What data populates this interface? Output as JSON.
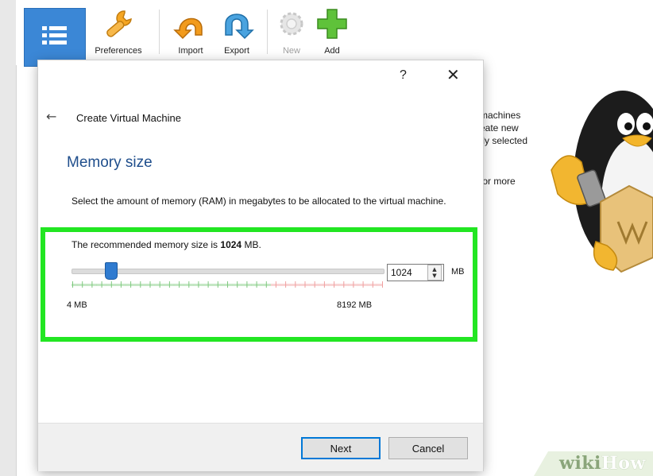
{
  "toolbar": {
    "items": [
      {
        "label": "Preferences",
        "icon": "wrench-icon",
        "enabled": true
      },
      {
        "label": "Import",
        "icon": "import-arrow-icon",
        "enabled": true
      },
      {
        "label": "Export",
        "icon": "export-arrow-icon",
        "enabled": true
      },
      {
        "label": "New",
        "icon": "new-gear-icon",
        "enabled": false
      },
      {
        "label": "Add",
        "icon": "plus-icon",
        "enabled": true
      }
    ]
  },
  "welcome": {
    "lines": [
      "machines",
      "eate new",
      "tly selected",
      "for more"
    ]
  },
  "dialog": {
    "help_glyph": "?",
    "close_glyph": "✕",
    "back_glyph": "←",
    "title": "Create Virtual Machine",
    "heading": "Memory size",
    "description": "Select the amount of memory (RAM) in megabytes to be allocated to the virtual machine.",
    "recommend_prefix": "The recommended memory size is ",
    "recommend_value": "1024",
    "recommend_suffix": " MB.",
    "slider": {
      "min_label": "4 MB",
      "max_label": "8192 MB",
      "min": 4,
      "max": 8192,
      "value": 1024,
      "safe_fraction": 0.63
    },
    "spinbox": {
      "value": "1024",
      "unit": "MB"
    },
    "buttons": {
      "next": "Next",
      "cancel": "Cancel"
    }
  },
  "watermark": {
    "part1": "wiki",
    "part2": "How"
  },
  "colors": {
    "highlight": "#22e622",
    "heading": "#1f4e8c",
    "slider_thumb": "#2f7bd0",
    "tick_green": "#7fc97f",
    "tick_red": "#f0a0a0"
  }
}
